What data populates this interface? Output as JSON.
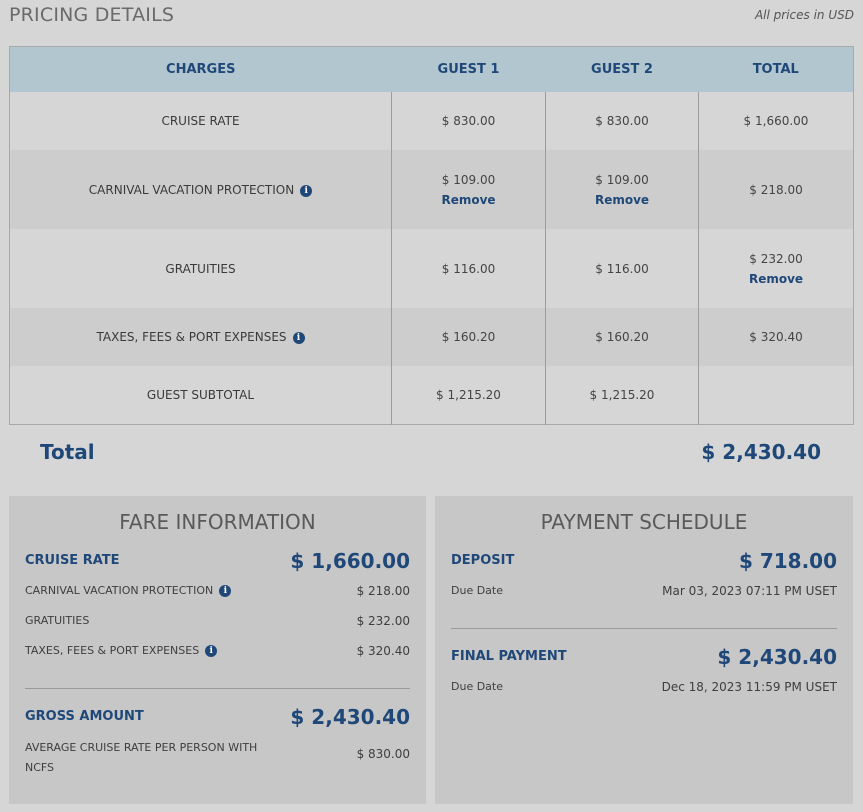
{
  "header": {
    "title": "PRICING DETAILS",
    "note": "All prices in USD"
  },
  "pricing_table": {
    "columns": [
      "CHARGES",
      "GUEST 1",
      "GUEST 2",
      "TOTAL"
    ],
    "rows": [
      {
        "charge": "CRUISE RATE",
        "guest1": "$ 830.00",
        "guest2": "$ 830.00",
        "total": "$ 1,660.00"
      },
      {
        "charge": "CARNIVAL VACATION PROTECTION",
        "guest1": "$ 109.00",
        "guest2": "$ 109.00",
        "total": "$ 218.00",
        "remove_label": "Remove"
      },
      {
        "charge": "GRATUITIES",
        "guest1": "$ 116.00",
        "guest2": "$ 116.00",
        "total": "$ 232.00",
        "remove_label": "Remove"
      },
      {
        "charge": "TAXES, FEES & PORT EXPENSES",
        "guest1": "$ 160.20",
        "guest2": "$ 160.20",
        "total": "$ 320.40"
      },
      {
        "charge": "GUEST SUBTOTAL",
        "guest1": "$ 1,215.20",
        "guest2": "$ 1,215.20",
        "total": ""
      }
    ]
  },
  "total": {
    "label": "Total",
    "value": "$ 2,430.40"
  },
  "fare_information": {
    "title": "FARE INFORMATION",
    "cruise_rate": {
      "label": "CRUISE RATE",
      "value": "$ 1,660.00"
    },
    "items": [
      {
        "label": "CARNIVAL VACATION PROTECTION",
        "value": "$ 218.00"
      },
      {
        "label": "GRATUITIES",
        "value": "$ 232.00"
      },
      {
        "label": "TAXES, FEES & PORT EXPENSES",
        "value": "$ 320.40"
      }
    ],
    "gross_amount": {
      "label": "GROSS AMOUNT",
      "value": "$ 2,430.40"
    },
    "average": {
      "label": "AVERAGE CRUISE RATE PER PERSON WITH NCFS",
      "value": "$ 830.00"
    }
  },
  "payment_schedule": {
    "title": "PAYMENT SCHEDULE",
    "deposit": {
      "label": "DEPOSIT",
      "value": "$ 718.00",
      "due_label": "Due Date",
      "due_date": "Mar 03, 2023 07:11 PM USET"
    },
    "final": {
      "label": "FINAL PAYMENT",
      "value": "$ 2,430.40",
      "due_label": "Due Date",
      "due_date": "Dec 18, 2023 11:59 PM USET"
    }
  },
  "colors": {
    "accent": "#1f4879",
    "header_bg": "#b2c6d0",
    "page_bg": "#d6d6d6",
    "panel_bg": "#c7c7c7"
  },
  "icons": {
    "info": "info-icon"
  }
}
